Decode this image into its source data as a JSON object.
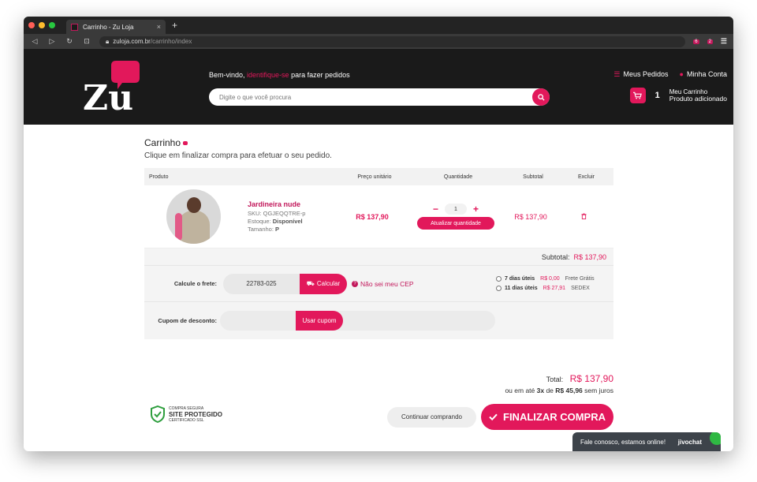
{
  "browser": {
    "tab_title": "Carrinho - Zu Loja",
    "tab_close": "×",
    "new_tab": "+",
    "url_domain": "zuloja.com.br",
    "url_path": "/carrinho/index",
    "ext_badge_1": "6",
    "ext_badge_2": "2",
    "menu": "☰"
  },
  "header": {
    "logo_text": "Zu",
    "welcome_prefix": "Bem-vindo, ",
    "welcome_link": "identifique-se",
    "welcome_suffix": " para fazer pedidos",
    "search_placeholder": "Digite o que você procura",
    "meus_pedidos": "Meus Pedidos",
    "minha_conta": "Minha Conta",
    "cart_count": "1",
    "cart_title": "Meu Carrinho",
    "cart_status": "Produto adicionado"
  },
  "cart": {
    "title": "Carrinho",
    "subtitle": "Clique em finalizar compra para efetuar o seu pedido.",
    "columns": [
      "Produto",
      "Preço unitário",
      "Quantidade",
      "Subtotal",
      "Excluir"
    ],
    "item": {
      "name": "Jardineira nude",
      "sku_label": "SKU:",
      "sku": "QGJEQQTRE-p",
      "stock_label": "Estoque:",
      "stock": "Disponível",
      "size_label": "Tamanho:",
      "size": "P",
      "unit_price": "R$ 137,90",
      "quantity": "1",
      "minus": "−",
      "plus": "+",
      "update_label": "Atualizar quantidade",
      "subtotal": "R$ 137,90"
    },
    "subtotal_label": "Subtotal:",
    "subtotal_value": "R$ 137,90",
    "shipping": {
      "label": "Calcule o frete:",
      "cep": "22783-025",
      "calc_label": "Calcular",
      "no_cep": "Não sei meu CEP",
      "options": [
        {
          "days": "7 dias úteis",
          "price": "R$ 0,00",
          "name": "Frete Grátis"
        },
        {
          "days": "11 dias úteis",
          "price": "R$ 27,91",
          "name": "SEDEX"
        }
      ]
    },
    "coupon": {
      "label": "Cupom de desconto:",
      "button": "Usar cupom"
    },
    "total_label": "Total:",
    "total_value": "R$ 137,90",
    "installments_prefix": "ou em até ",
    "installments_count": "3x",
    "installments_mid": " de ",
    "installments_value": "R$ 45,96",
    "installments_suffix": " sem juros",
    "continue_label": "Continuar comprando",
    "finish_label": "FINALIZAR COMPRA"
  },
  "seal": {
    "top": "COMPRA SEGURA",
    "main": "SITE PROTEGIDO",
    "bottom": "CERTIFICADO SSL"
  },
  "chat": {
    "message": "Fale conosco, estamos online!",
    "brand": "jivochat"
  },
  "colors": {
    "brand": "#e2185b",
    "header_bg": "#1a1a1a"
  }
}
